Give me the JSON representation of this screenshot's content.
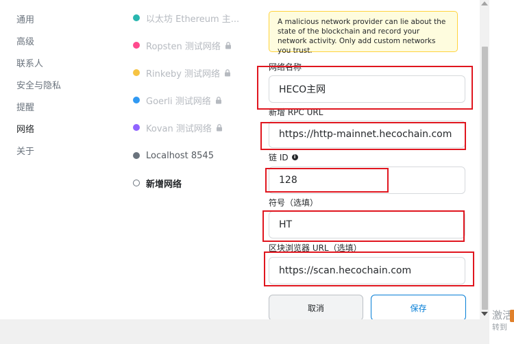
{
  "settings_menu": {
    "items": [
      {
        "label": "通用",
        "active": false
      },
      {
        "label": "高级",
        "active": false
      },
      {
        "label": "联系人",
        "active": false
      },
      {
        "label": "安全与隐私",
        "active": false
      },
      {
        "label": "提醒",
        "active": false
      },
      {
        "label": "网络",
        "active": true
      },
      {
        "label": "关于",
        "active": false
      }
    ]
  },
  "networks": {
    "items": [
      {
        "label": "以太坊 Ethereum 主...",
        "color": "#29b6af",
        "locked": true
      },
      {
        "label": "Ropsten 测试网络",
        "color": "#ff4a8d",
        "locked": true
      },
      {
        "label": "Rinkeby 测试网络",
        "color": "#f6c343",
        "locked": true
      },
      {
        "label": "Goerli 测试网络",
        "color": "#3099f2",
        "locked": true
      },
      {
        "label": "Kovan 测试网络",
        "color": "#9064ff",
        "locked": true
      },
      {
        "label": "Localhost 8545",
        "color": "#6a737d",
        "locked": false
      }
    ],
    "add_network_label": "新增网络"
  },
  "form": {
    "warning_text": "A malicious network provider can lie about the state of the blockchain and record your network activity. Only add custom networks you trust.",
    "network_name_label": "网络名称",
    "network_name_value": "HECO主网",
    "rpc_url_label": "新增 RPC URL",
    "rpc_url_value": "https://http-mainnet.hecochain.com",
    "chain_id_label": "链 ID",
    "chain_id_value": "128",
    "symbol_label": "符号（选填）",
    "symbol_value": "HT",
    "explorer_label": "区块浏览器 URL（选填）",
    "explorer_value": "https://scan.hecochain.com",
    "cancel_label": "取消",
    "save_label": "保存"
  },
  "watermark": {
    "line1": "激活",
    "line2": "转到"
  },
  "colors": {
    "annotation_red": "#e0151e",
    "accent_blue": "#037dd6",
    "warning_bg": "#fefcde",
    "warning_border": "#ffd33d"
  }
}
